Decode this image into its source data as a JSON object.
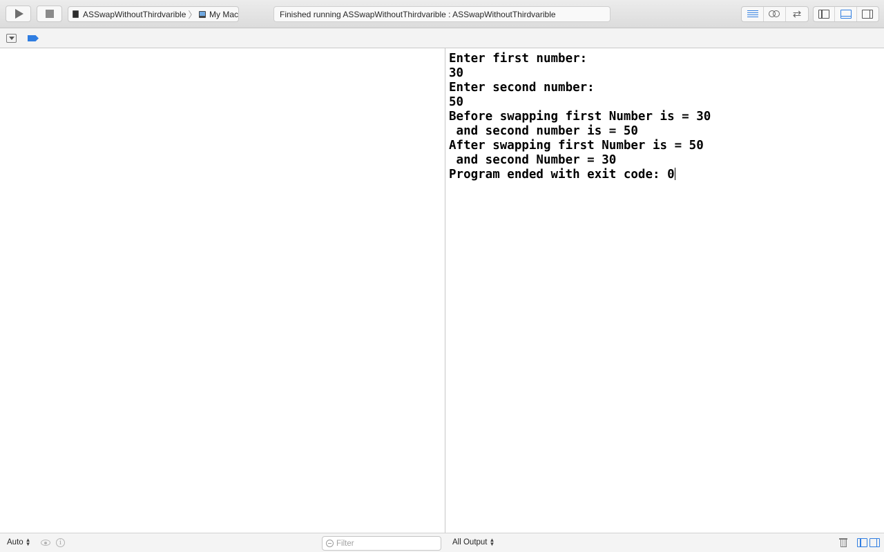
{
  "toolbar": {
    "run_icon": "play-icon",
    "stop_icon": "stop-icon",
    "scheme": {
      "target": "ASSwapWithoutThirdvarible",
      "separator": "〉",
      "destination": "My Mac"
    },
    "activity_status": "Finished running ASSwapWithoutThirdvarible : ASSwapWithoutThirdvarible",
    "editor_modes": [
      "standard-editor-icon",
      "assistant-editor-icon",
      "version-editor-icon"
    ],
    "view_toggles": [
      "navigator-toggle-icon",
      "debug-area-toggle-icon",
      "utilities-toggle-icon"
    ],
    "accent_color": "#2f7de1"
  },
  "debug_bar": {
    "hide_icon": "hide-debug-area-icon",
    "breakpoints_icon": "breakpoint-icon"
  },
  "console": {
    "lines": [
      "Enter first number:",
      "30",
      "Enter second number:",
      "50",
      "Before swapping first Number is = 30",
      " and second number is = 50",
      "After swapping first Number is = 50",
      " and second Number = 30",
      "Program ended with exit code: 0"
    ]
  },
  "bottom_bar": {
    "variables_scope": "Auto",
    "filter_placeholder": "Filter",
    "output_scope": "All Output"
  }
}
